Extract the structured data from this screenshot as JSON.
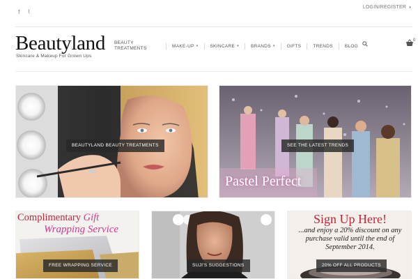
{
  "topbar": {
    "social": [
      {
        "icon": "facebook-icon",
        "glyph": "f"
      },
      {
        "icon": "twitter-icon",
        "glyph": "t"
      }
    ],
    "login_label": "LOGIN/REGISTER",
    "login_caret": "▾"
  },
  "header": {
    "logo": "Beautyland",
    "tagline": "Skincare & Makeup For Grown Ups"
  },
  "nav": {
    "items": [
      {
        "label": "BEAUTY TREATMENTS",
        "dropdown": false
      },
      {
        "label": "MAKE-UP",
        "dropdown": true
      },
      {
        "label": "SKINCARE",
        "dropdown": true
      },
      {
        "label": "BRANDS",
        "dropdown": true
      },
      {
        "label": "GIFTS",
        "dropdown": false
      },
      {
        "label": "TRENDS",
        "dropdown": false
      },
      {
        "label": "BLOG",
        "dropdown": false
      }
    ],
    "caret": "▾",
    "cart_count": "0"
  },
  "tiles": [
    {
      "button": "BEAUTYLAND BEAUTY TREATMENTS"
    },
    {
      "button": "SEE THE LATEST TRENDS",
      "overlay_text": "Pastel Perfect"
    },
    {
      "button": "FREE WRAPPING SERVICE",
      "title_line1_a": "Complimentary ",
      "title_line1_b": "Gift",
      "title_line2": "Wrapping Service"
    },
    {
      "button": "SUJI'S SUGGESTIONS"
    },
    {
      "button": "20% OFF ALL PRODUCTS",
      "title": "Sign Up Here!",
      "body": "...and enjoy a 20% discount on any purchase valid until the end of September 2014."
    }
  ],
  "colors": {
    "accent_red": "#c0273a",
    "accent_pink": "#d23b8c",
    "dark_button": "#282828"
  }
}
